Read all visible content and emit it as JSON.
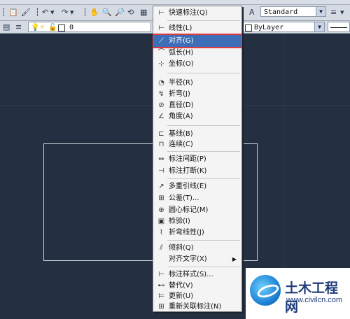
{
  "toolbar": {
    "text_style": "Standard",
    "layer_value": "0",
    "color_value": "ByLayer"
  },
  "menu": {
    "items": [
      {
        "icon": "quick-dimension-icon",
        "label": "快速标注(Q)"
      },
      {
        "icon": "linear-icon",
        "label": "线性(L)"
      },
      {
        "icon": "aligned-icon",
        "label": "对齐(G)",
        "highlighted": true
      },
      {
        "icon": "arc-length-icon",
        "label": "弧长(H)"
      },
      {
        "icon": "ordinate-icon",
        "label": "坐标(O)"
      },
      {
        "icon": "radius-icon",
        "label": "半径(R)"
      },
      {
        "icon": "jogged-icon",
        "label": "折弯(J)"
      },
      {
        "icon": "diameter-icon",
        "label": "直径(D)"
      },
      {
        "icon": "angular-icon",
        "label": "角度(A)"
      },
      {
        "icon": "baseline-icon",
        "label": "基线(B)"
      },
      {
        "icon": "continue-icon",
        "label": "连续(C)"
      },
      {
        "icon": "dim-space-icon",
        "label": "标注间距(P)"
      },
      {
        "icon": "dim-break-icon",
        "label": "标注打断(K)"
      },
      {
        "icon": "multileader-icon",
        "label": "多重引线(E)"
      },
      {
        "icon": "tolerance-icon",
        "label": "公差(T)..."
      },
      {
        "icon": "center-mark-icon",
        "label": "圆心标记(M)"
      },
      {
        "icon": "inspection-icon",
        "label": "检验(I)"
      },
      {
        "icon": "jogged-linear-icon",
        "label": "折弯线性(J)"
      },
      {
        "icon": "oblique-icon",
        "label": "倾斜(Q)"
      },
      {
        "icon": "align-text-icon",
        "label": "对齐文字(X)"
      },
      {
        "icon": "dim-style-icon",
        "label": "标注样式(S)..."
      },
      {
        "icon": "override-icon",
        "label": "替代(V)"
      },
      {
        "icon": "update-icon",
        "label": "更新(U)"
      },
      {
        "icon": "reassociate-icon",
        "label": "重新关联标注(N)"
      }
    ]
  },
  "watermark": {
    "name": "土木工程网",
    "url": "www.civilcn.com"
  }
}
